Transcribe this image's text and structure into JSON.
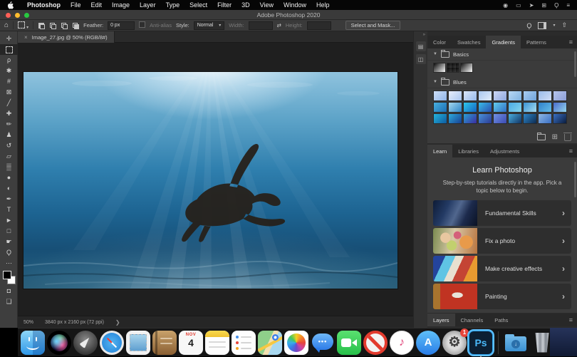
{
  "menu_bar": {
    "items": [
      "Photoshop",
      "File",
      "Edit",
      "Image",
      "Layer",
      "Type",
      "Select",
      "Filter",
      "3D",
      "View",
      "Window",
      "Help"
    ],
    "status_icons": [
      {
        "name": "camera-icon",
        "glyph": "◉"
      },
      {
        "name": "display-icon",
        "glyph": "▭"
      },
      {
        "name": "location-arrow-icon",
        "glyph": "➤"
      },
      {
        "name": "displays-icon",
        "glyph": "⊞"
      },
      {
        "name": "spotlight-search-icon",
        "glyph": "Ϙ"
      },
      {
        "name": "control-center-icon",
        "glyph": "≡"
      }
    ]
  },
  "window": {
    "title": "Adobe Photoshop 2020"
  },
  "options_bar": {
    "feather_label": "Feather:",
    "feather_value": "0 px",
    "anti_alias_label": "Anti-alias",
    "style_label": "Style:",
    "style_value": "Normal",
    "width_label": "Width:",
    "height_label": "Height:",
    "select_mask_label": "Select and Mask..."
  },
  "toolbar": {
    "tools": [
      {
        "name": "move-tool",
        "glyph": "✛"
      },
      {
        "name": "marquee-tool",
        "type": "marquee",
        "active": true
      },
      {
        "name": "lasso-tool",
        "glyph": "ρ"
      },
      {
        "name": "quick-selection-tool",
        "glyph": "✱"
      },
      {
        "name": "crop-tool",
        "glyph": "#"
      },
      {
        "name": "frame-tool",
        "glyph": "⊠"
      },
      {
        "name": "eyedropper-tool",
        "glyph": "╱"
      },
      {
        "name": "healing-brush-tool",
        "glyph": "✚"
      },
      {
        "name": "brush-tool",
        "glyph": "✏"
      },
      {
        "name": "clone-stamp-tool",
        "glyph": "♟"
      },
      {
        "name": "history-brush-tool",
        "glyph": "↺"
      },
      {
        "name": "eraser-tool",
        "glyph": "▱"
      },
      {
        "name": "gradient-tool",
        "glyph": "▒"
      },
      {
        "name": "blur-tool",
        "glyph": "●"
      },
      {
        "name": "dodge-tool",
        "glyph": "◐"
      },
      {
        "name": "pen-tool",
        "glyph": "✒"
      },
      {
        "name": "type-tool",
        "glyph": "T"
      },
      {
        "name": "path-selection-tool",
        "glyph": "►"
      },
      {
        "name": "shape-tool",
        "glyph": "□"
      },
      {
        "name": "hand-tool",
        "glyph": "☛"
      },
      {
        "name": "zoom-tool",
        "glyph": "Ϙ"
      },
      {
        "name": "toolbar-options",
        "glyph": "⋯"
      },
      {
        "name": "color-swatches",
        "type": "colors"
      },
      {
        "name": "quick-mask-icon",
        "glyph": "◘"
      },
      {
        "name": "screen-mode-icon",
        "glyph": "❏"
      }
    ]
  },
  "document": {
    "tab_title": "Image_27.jpg @ 50% (RGB/8#)",
    "status_zoom": "50%",
    "status_dimensions": "3840 px x 2160 px (72 ppi)"
  },
  "panels": {
    "top_tabs": {
      "labels": [
        "Color",
        "Swatches",
        "Gradients",
        "Patterns"
      ],
      "active": 2
    },
    "gradients": {
      "groups": [
        {
          "name": "Basics",
          "swatches": [
            {
              "from": "#0a0a0a",
              "to": "#f8f8f8"
            },
            {
              "from": "#0a0a0a",
              "to": "rgba(0,0,0,0)",
              "checker": true
            },
            {
              "from": "#111111",
              "to": "#fdfdfd"
            }
          ]
        },
        {
          "name": "Blues",
          "swatches": [
            {
              "from": "#cfe0f8",
              "to": "#8fb4e8"
            },
            {
              "from": "#e9eefb",
              "to": "#a9c6f0"
            },
            {
              "from": "#dce8fa",
              "to": "#96b8ea"
            },
            {
              "from": "#a9c8f0",
              "to": "#e2ecfa"
            },
            {
              "from": "#cdd8f4",
              "to": "#8fa8e0"
            },
            {
              "from": "#b9d8f4",
              "to": "#7fb2e0"
            },
            {
              "from": "#a9cdf0",
              "to": "#6fa2da"
            },
            {
              "from": "#9bbcea",
              "to": "#d2ddf4"
            },
            {
              "from": "#b5c4ec",
              "to": "#8d9fd8"
            },
            {
              "from": "#49b0e0",
              "to": "#1b6fb4"
            },
            {
              "from": "#a5d8ee",
              "to": "#2e86c8"
            },
            {
              "from": "#2ec8ec",
              "to": "#1565c0"
            },
            {
              "from": "#38bce8",
              "to": "#2a4fb0"
            },
            {
              "from": "#63cdee",
              "to": "#2f6fc4"
            },
            {
              "from": "#4aaae4",
              "to": "#85d4ec"
            },
            {
              "from": "#3a93d4",
              "to": "#a5dcf0"
            },
            {
              "from": "#2f82cc",
              "to": "#66bce8"
            },
            {
              "from": "#4a6ccc",
              "to": "#92d4ec"
            },
            {
              "from": "#25b4dc",
              "to": "#0d5aa0"
            },
            {
              "from": "#2eaadc",
              "to": "#173f92"
            },
            {
              "from": "#2aa0d4",
              "to": "#3b2ba0"
            },
            {
              "from": "#4a92dc",
              "to": "#2b3a92"
            },
            {
              "from": "#7292e4",
              "to": "#3b4ab2"
            },
            {
              "from": "#4aaede",
              "to": "#113464"
            },
            {
              "from": "#2e86c8",
              "to": "#0d2a50"
            },
            {
              "from": "#8fb8e4",
              "to": "#3a6fc4"
            },
            {
              "from": "#3a6fc4",
              "to": "#0a1c3c"
            }
          ]
        }
      ]
    },
    "learn": {
      "tabs": {
        "labels": [
          "Learn",
          "Libraries",
          "Adjustments"
        ],
        "active": 0
      },
      "title": "Learn Photoshop",
      "description": "Step-by-step tutorials directly in the app. Pick a topic below to begin.",
      "items": [
        {
          "label": "Fundamental Skills",
          "thumb": "thumb-fundamental"
        },
        {
          "label": "Fix a photo",
          "thumb": "thumb-fix"
        },
        {
          "label": "Make creative effects",
          "thumb": "thumb-creative"
        },
        {
          "label": "Painting",
          "thumb": "thumb-painting"
        }
      ]
    },
    "bottom_tabs": {
      "labels": [
        "Layers",
        "Channels",
        "Paths"
      ],
      "active": 0
    }
  },
  "dock": {
    "apps": [
      "finder",
      "siri",
      "launchpad",
      "safari",
      "mail",
      "contacts",
      "calendar",
      "notes",
      "reminders",
      "maps",
      "photos",
      "messages",
      "facetime",
      "blocked",
      "music",
      "app-store",
      "system-preferences",
      "photoshop",
      "separator",
      "downloads",
      "trash"
    ],
    "calendar": {
      "month": "NOV",
      "day": "4"
    },
    "system_preferences_badge": "1",
    "photoshop_label": "Ps",
    "running_apps": [
      "finder",
      "photoshop"
    ]
  },
  "colors": {
    "ps_accent": "#31a8ff",
    "panel_bg": "#3b3b3b",
    "canvas_bg": "#1f1f1f",
    "menu_bg": "#060606",
    "dock_bg": "#151515",
    "traffic_red": "#ff5f57",
    "traffic_yellow": "#febc2e",
    "traffic_green": "#28c840"
  }
}
